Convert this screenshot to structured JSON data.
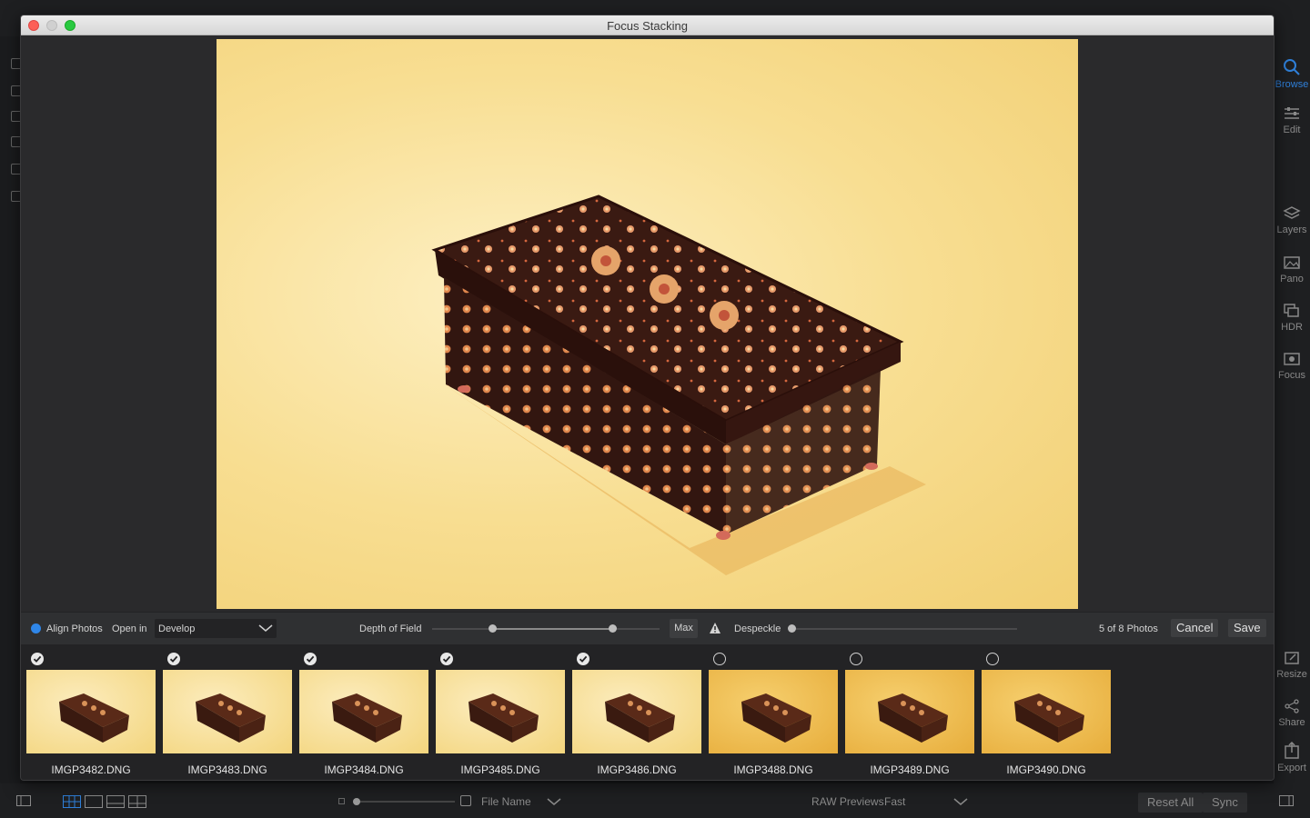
{
  "dialog": {
    "title": "Focus Stacking"
  },
  "controls": {
    "align_photos_label": "Align Photos",
    "open_in_label": "Open in",
    "open_in_value": "Develop",
    "depth_of_field_label": "Depth of Field",
    "max_label": "Max",
    "despeckle_label": "Despeckle",
    "photo_count": "5 of 8 Photos",
    "cancel_label": "Cancel",
    "save_label": "Save"
  },
  "thumbnails": [
    {
      "name": "IMGP3482.DNG",
      "selected": true
    },
    {
      "name": "IMGP3483.DNG",
      "selected": true
    },
    {
      "name": "IMGP3484.DNG",
      "selected": true
    },
    {
      "name": "IMGP3485.DNG",
      "selected": true
    },
    {
      "name": "IMGP3486.DNG",
      "selected": true
    },
    {
      "name": "IMGP3488.DNG",
      "selected": false
    },
    {
      "name": "IMGP3489.DNG",
      "selected": false
    },
    {
      "name": "IMGP3490.DNG",
      "selected": false
    }
  ],
  "right_panel": {
    "tools": [
      "Browse",
      "Edit",
      "Layers",
      "Pano",
      "HDR",
      "Focus",
      "Resize",
      "Share",
      "Export"
    ],
    "active": "Browse"
  },
  "bottom_bar": {
    "sort_label": "File Name",
    "raw_previews_label": "RAW Previews",
    "raw_previews_value": "Fast",
    "reset_all_label": "Reset All",
    "sync_label": "Sync"
  },
  "colors": {
    "accent": "#2f86e8",
    "dialog_bg": "#2a2a2c",
    "strip_bg": "#232325"
  }
}
